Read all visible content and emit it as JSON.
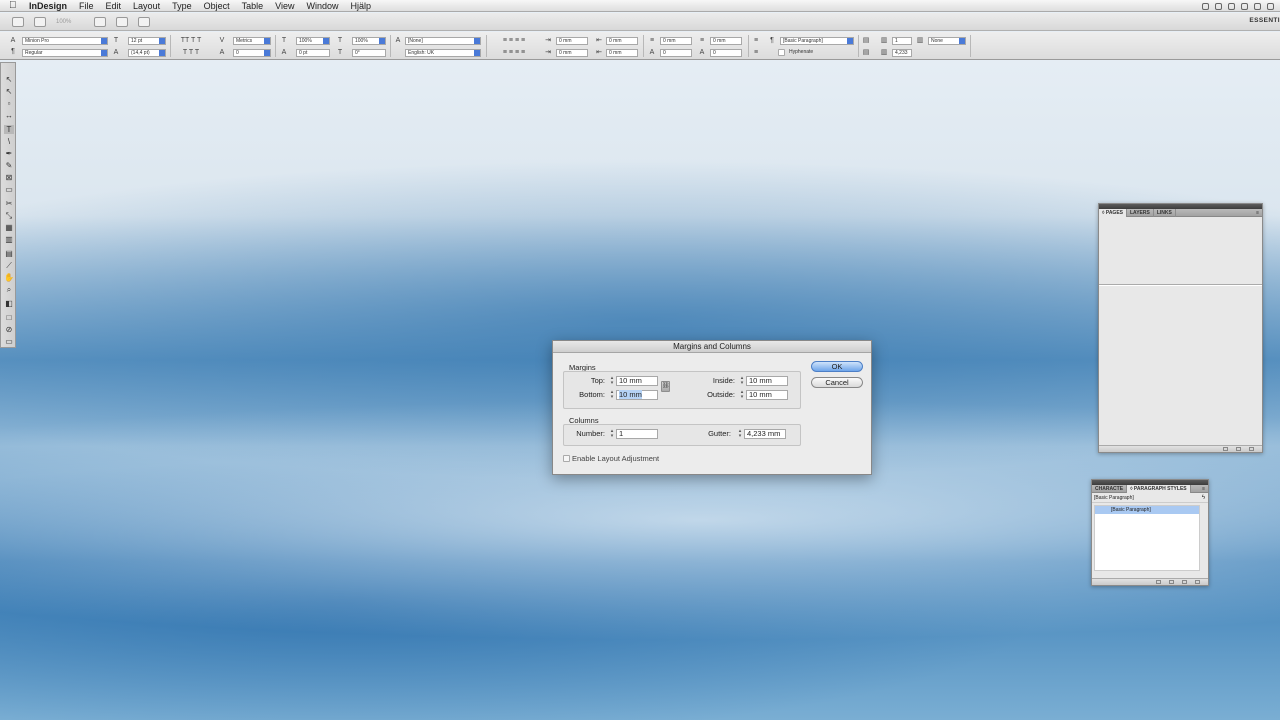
{
  "menubar": {
    "app": "InDesign",
    "items": [
      "File",
      "Edit",
      "Layout",
      "Type",
      "Object",
      "Table",
      "View",
      "Window",
      "Hjälp"
    ]
  },
  "appbar": {
    "zoom": "100%",
    "workspace": "ESSENTI"
  },
  "control_panel": {
    "font_family": "Minion Pro",
    "font_style": "Regular",
    "font_size": "12 pt",
    "leading": "(14,4 pt)",
    "kerning": "Metrics",
    "tracking": "0",
    "vertical_scale": "100%",
    "baseline_shift": "0 pt",
    "horizontal_scale": "100%",
    "skew": "0°",
    "character_style": "[None]",
    "language": "English: UK",
    "left_indent": "0 mm",
    "first_line_indent": "0 mm",
    "right_indent": "0 mm",
    "last_line_indent": "0 mm",
    "space_before": "0 mm",
    "space_after": "0 mm",
    "drop_cap_lines": "0",
    "drop_cap_chars": "0",
    "paragraph_style": "[Basic Paragraph]",
    "hyphenate_label": "Hyphenate",
    "columns": "1",
    "gutter": "4,233",
    "span": "None"
  },
  "dialog": {
    "title": "Margins and Columns",
    "margins_label": "Margins",
    "top_label": "Top:",
    "top_value": "10 mm",
    "bottom_label": "Bottom:",
    "bottom_value": "10 mm",
    "inside_label": "Inside:",
    "inside_value": "10 mm",
    "outside_label": "Outside:",
    "outside_value": "10 mm",
    "columns_label": "Columns",
    "number_label": "Number:",
    "number_value": "1",
    "gutter_label": "Gutter:",
    "gutter_value": "4,233 mm",
    "enable_layout_adjustment": "Enable Layout Adjustment",
    "ok_label": "OK",
    "cancel_label": "Cancel"
  },
  "pages_panel": {
    "tabs": [
      "◊ PAGES",
      "LAYERS",
      "LINKS"
    ]
  },
  "styles_panel": {
    "tabs": [
      "CHARACTE",
      "◊ PARAGRAPH STYLES"
    ],
    "current_style": "[Basic Paragraph]",
    "items": [
      "[Basic Paragraph]"
    ]
  }
}
